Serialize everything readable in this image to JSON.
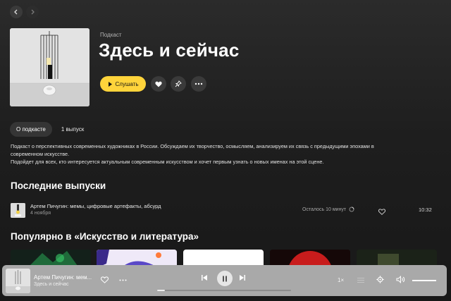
{
  "podcast": {
    "type_label": "Подкаст",
    "title": "Здесь и сейчас",
    "listen_label": "Слушать",
    "description_line1": "Подкаст о перспективных современных художниках в России. Обсуждаем их творчество, осмысляем, анализируем их связь с предыдущими эпохами в современном искусстве.",
    "description_line2": "Подойдет для всех, кто интересуется актуальным современным искусством и хочет первым узнать о новых именах на этой сцене."
  },
  "tabs": [
    {
      "label": "О подкасте",
      "active": true
    },
    {
      "label": "1 выпуск",
      "active": false
    }
  ],
  "latest": {
    "heading": "Последние выпуски",
    "episodes": [
      {
        "title": "Артем Пичугин: мемы, цифровые артефакты, абсурд",
        "date": "4 ноября",
        "remaining": "Осталось 10 минут",
        "duration": "10:32"
      }
    ]
  },
  "popular": {
    "heading": "Популярно в «Искусство и литература»",
    "card_colors": [
      "#1f3a2a",
      "#efeaf7",
      "#ffffff",
      "#c21b1b",
      "#2a3326"
    ]
  },
  "player": {
    "title": "Артем Пичугин: мем...",
    "subtitle": "Здесь и сейчас",
    "speed": "1×",
    "progress": 0.06,
    "volume": 1.0
  },
  "icons": {
    "back": "chevron-left-icon",
    "forward": "chevron-right-icon",
    "like": "heart-icon",
    "pin": "pin-icon",
    "more": "more-icon"
  },
  "colors": {
    "accent": "#ffd43b",
    "background": "#1e1e1e",
    "player_bar": "#a9a9a9"
  }
}
